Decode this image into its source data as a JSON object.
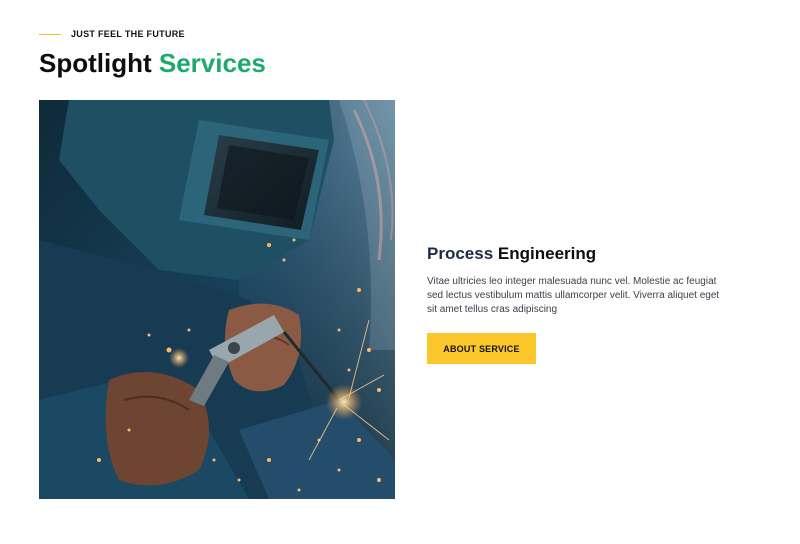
{
  "header": {
    "eyebrow": "JUST FEEL THE FUTURE",
    "title_part1": "Spotlight",
    "title_part2": "Services"
  },
  "service": {
    "title_part1": "Process",
    "title_part2": "Engineering",
    "description": "Vitae ultricies leo integer malesuada nunc vel. Molestie ac feugiat sed lectus vestibulum mattis ullamcorper velit. Viverra aliquet eget sit amet tellus cras adipiscing",
    "button_label": "ABOUT SERVICE"
  },
  "colors": {
    "accent_green": "#1fa971",
    "accent_yellow": "#fcc72b",
    "eyebrow_line": "#f5b82e",
    "heading_dark": "#0e0e12"
  },
  "image": {
    "subject": "welder-at-work-photo"
  }
}
